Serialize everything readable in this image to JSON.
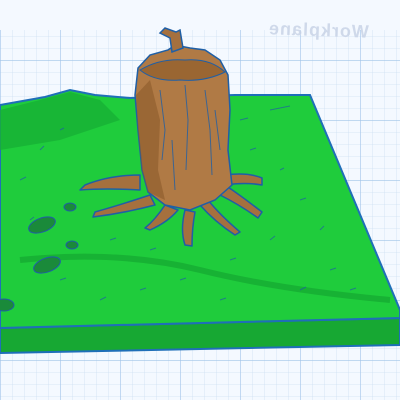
{
  "viewport": {
    "workplane_label": "Workplane",
    "grid_color": "#b9d3ee",
    "grid_major_color": "#97bde6",
    "background": "#f4f9ff"
  },
  "model": {
    "terrain_color": "#1ec93a",
    "terrain_dark": "#0f9c2c",
    "edge_color": "#1f6fb8",
    "stump_color": "#b07a45",
    "stump_dark": "#7a4d22",
    "selected": true
  }
}
